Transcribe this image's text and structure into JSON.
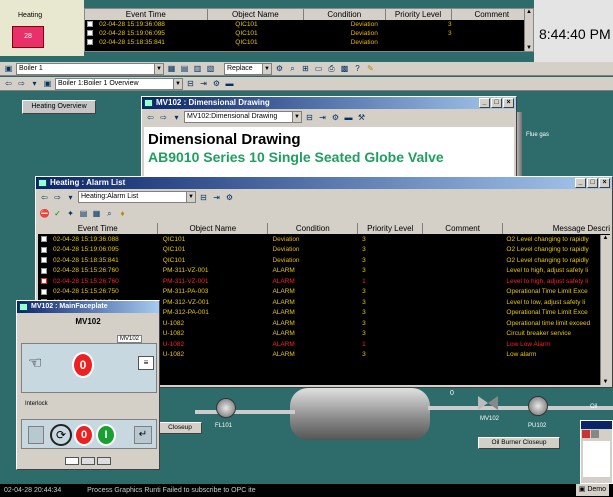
{
  "heating_label": "Heating",
  "heating_btn": "28",
  "clock": "8:44:40 PM",
  "top_events": {
    "headers": [
      "Event Time",
      "Object Name",
      "Condition",
      "Priority Level",
      "Comment"
    ],
    "rows": [
      {
        "time": "02-04-28 15:19:36:088",
        "object": "QIC101",
        "condition": "Deviation",
        "priority": "3"
      },
      {
        "time": "02-04-28 15:19:06:095",
        "object": "QIC101",
        "condition": "Deviation",
        "priority": "3"
      },
      {
        "time": "02-04-28 15:18:35:841",
        "object": "QIC101",
        "condition": "Deviation",
        "priority": ""
      }
    ]
  },
  "boiler_bar": {
    "combo": "Boiler 1",
    "replace": "Replace"
  },
  "boiler_path": "Boiler 1:Boiler 1 Overview",
  "heating_overview": "Heating Overview",
  "dim_window": {
    "title": "MV102 : Dimensional Drawing",
    "combo": "MV102:Dimensional Drawing",
    "heading": "Dimensional Drawing",
    "subheading": "AB9010 Series 10 Single Seated Globe Valve"
  },
  "flue_gas": "Flue gas",
  "alarm_window": {
    "title": "Heating : Alarm List",
    "combo": "Heating:Alarm List",
    "headers": [
      "Event Time",
      "Object Name",
      "Condition",
      "Priority Level",
      "Comment",
      "Message Description"
    ],
    "rows": [
      {
        "time": "02-04-28 15:19:36:088",
        "object": "QIC101",
        "condition": "Deviation",
        "priority": "3",
        "message": "O2 Level changing to rapidly"
      },
      {
        "time": "02-04-28 15:19:06:095",
        "object": "QIC101",
        "condition": "Deviation",
        "priority": "3",
        "message": "O2 Level changing to rapidly"
      },
      {
        "time": "02-04-28 15:18:35:841",
        "object": "QIC101",
        "condition": "Deviation",
        "priority": "3",
        "message": "O2 Level changing to rapidly"
      },
      {
        "time": "02-04-28 15:15:26:760",
        "object": "PM-311-VZ-001",
        "condition": "ALARM",
        "priority": "3",
        "message": "Level to high, adjust safety li"
      },
      {
        "time": "02-04-28 15:15:26:760",
        "object": "PM-311-VZ-001",
        "condition": "ALARM",
        "priority": "1",
        "message": "Level to high, adjust safety li"
      },
      {
        "time": "02-04-28 15:15:26:750",
        "object": "PM-311-PA-003",
        "condition": "ALARM",
        "priority": "3",
        "message": "Operational Time Limit Exce"
      },
      {
        "time": "02-04-28 15:15:26:710",
        "object": "PM-312-VZ-001",
        "condition": "ALARM",
        "priority": "3",
        "message": "Level to low, adjust safety li"
      },
      {
        "time": "02-04-28 15:15:26:690",
        "object": "PM-312-PA-001",
        "condition": "ALARM",
        "priority": "3",
        "message": "Operational Time Limit Exce"
      },
      {
        "time": "",
        "object": "U-1082",
        "condition": "ALARM",
        "priority": "3",
        "message": "Operational time limit exceed"
      },
      {
        "time": "",
        "object": "U-1082",
        "condition": "ALARM",
        "priority": "3",
        "message": "Circuit breaker service"
      },
      {
        "time": "",
        "object": "U-1082",
        "condition": "ALARM",
        "priority": "1",
        "message": "Low Low Alarm"
      },
      {
        "time": "",
        "object": "U-1082",
        "condition": "ALARM",
        "priority": "3",
        "message": "Low alarm"
      }
    ]
  },
  "faceplate": {
    "title": "MV102 : MainFaceplate",
    "name": "MV102",
    "tag": "MV102",
    "interlock": "Interlock"
  },
  "process": {
    "fl101": "FL101",
    "mv102": "MV102",
    "pu102": "PU102",
    "closeup": "Closeup",
    "oil_closeup": "Oil Burner Closeup",
    "zero": "0",
    "oil": "Oil"
  },
  "status_bar": {
    "time": "02-04-28 20:44:34",
    "message": "Process Graphics Runti Failed to subscribe to OPC ite",
    "demo": "Demo"
  },
  "colors": {
    "alarm_red": "#ff2020",
    "deviation": "#e7b400",
    "text_yellow": "#e8c800",
    "dim_green": "#1fa060"
  }
}
